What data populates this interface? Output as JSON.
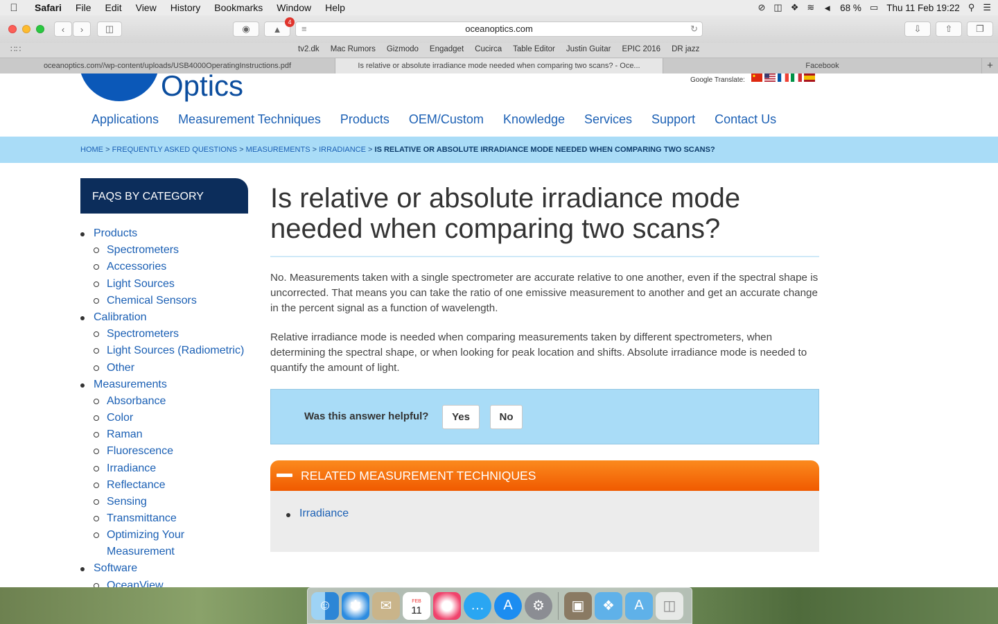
{
  "menubar": {
    "app": "Safari",
    "items": [
      "File",
      "Edit",
      "View",
      "History",
      "Bookmarks",
      "Window",
      "Help"
    ],
    "battery": "68 %",
    "datetime": "Thu 11 Feb  19:22"
  },
  "toolbar": {
    "url": "oceanoptics.com",
    "notification_badge": "4"
  },
  "bookmarks": [
    "tv2.dk",
    "Mac Rumors",
    "Gizmodo",
    "Engadget",
    "Cucirca",
    "Table Editor",
    "Justin Guitar",
    "EPIC 2016",
    "DR jazz"
  ],
  "tabs": [
    {
      "label": "oceanoptics.com//wp-content/uploads/USB4000OperatingInstructions.pdf"
    },
    {
      "label": "Is relative or absolute irradiance mode needed when comparing two scans? - Oce..."
    },
    {
      "label": "Facebook"
    }
  ],
  "site": {
    "logo_text": "Optics",
    "translate_label": "Google Translate:",
    "nav": [
      "Applications",
      "Measurement Techniques",
      "Products",
      "OEM/Custom",
      "Knowledge",
      "Services",
      "Support",
      "Contact Us"
    ]
  },
  "breadcrumb": {
    "home": "HOME",
    "faq": "FREQUENTLY ASKED QUESTIONS",
    "measurements": "MEASUREMENTS",
    "irradiance": "IRRADIANCE",
    "current": "IS RELATIVE OR ABSOLUTE IRRADIANCE MODE NEEDED WHEN COMPARING TWO SCANS?",
    "sep": ">"
  },
  "sidebar": {
    "title": "FAQS BY CATEGORY",
    "products": "Products",
    "products_items": [
      "Spectrometers",
      "Accessories",
      "Light Sources",
      "Chemical Sensors"
    ],
    "calibration": "Calibration",
    "calibration_items": [
      "Spectrometers",
      "Light Sources (Radiometric)",
      "Other"
    ],
    "measurements": "Measurements",
    "measurements_items": [
      "Absorbance",
      "Color",
      "Raman",
      "Fluorescence",
      "Irradiance",
      "Reflectance",
      "Sensing",
      "Transmittance",
      "Optimizing Your Measurement"
    ],
    "software": "Software",
    "software_items": [
      "OceanView"
    ]
  },
  "article": {
    "title": "Is relative or absolute irradiance mode needed when comparing two scans?",
    "p1": "No. Measurements taken with a single spectrometer are accurate relative to one another, even if the spectral shape is uncorrected. That means you can take the ratio of one emissive measurement to another and get an accurate change in the percent signal as a function of wavelength.",
    "p2": "Relative irradiance mode is needed when comparing measurements taken by different spectrometers, when determining the spectral shape, or when looking for peak location and shifts. Absolute irradiance mode is needed to quantify the amount of light.",
    "helpful_q": "Was this answer helpful?",
    "yes": "Yes",
    "no": "No"
  },
  "related": {
    "title": "RELATED MEASUREMENT TECHNIQUES",
    "items": [
      "Irradiance"
    ]
  },
  "dock": {
    "calendar_month": "FEB",
    "calendar_day": "11"
  }
}
